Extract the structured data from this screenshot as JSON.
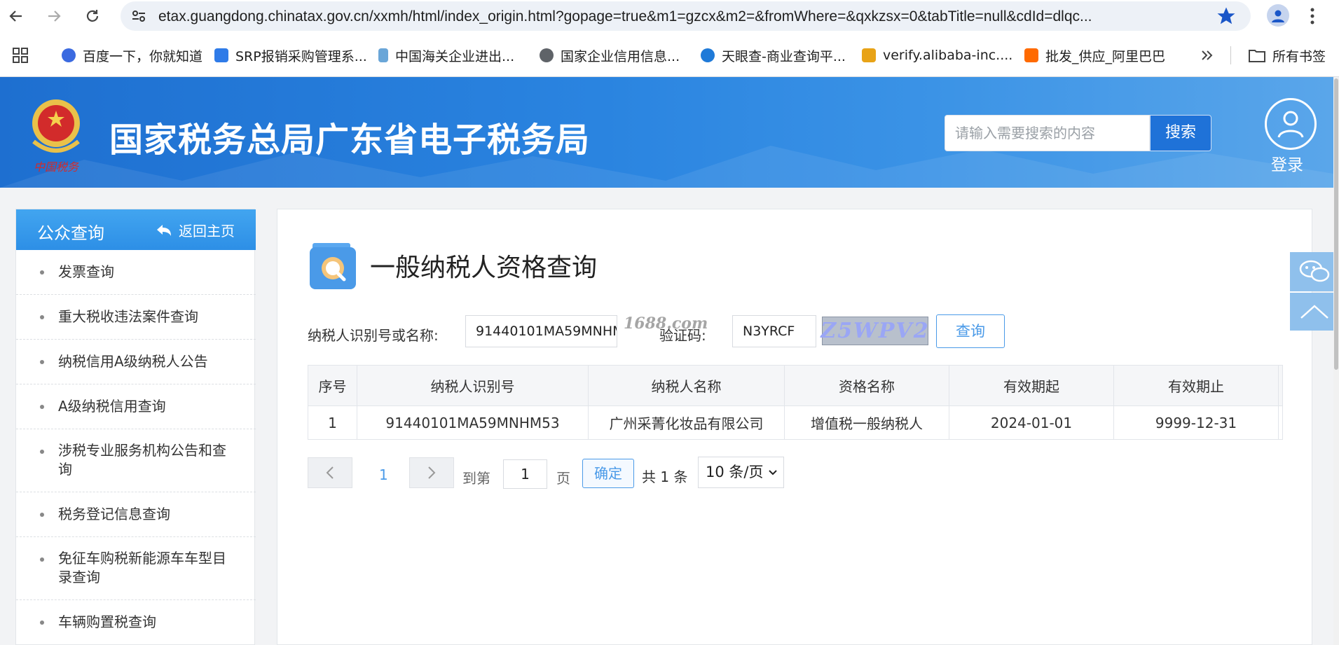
{
  "browser": {
    "url": "etax.guangdong.chinatax.gov.cn/xxmh/html/index_origin.html?gopage=true&m1=gzcx&m2=&fromWhere=&qxkzsx=0&tabTitle=null&cdId=dlqc...",
    "bookmarks": [
      {
        "label": "百度一下，你就知道",
        "color": "#3b6ae0"
      },
      {
        "label": "SRP报销采购管理系...",
        "color": "#2f7be8"
      },
      {
        "label": "中国海关企业进出...",
        "color": "#6aa6d8"
      },
      {
        "label": "国家企业信用信息...",
        "color": "#5f6368"
      },
      {
        "label": "天眼查-商业查询平...",
        "color": "#1f7ad8"
      },
      {
        "label": "verify.alibaba-inc....",
        "color": "#e8a317"
      },
      {
        "label": "批发_供应_阿里巴巴",
        "color": "#ff6a00"
      }
    ],
    "all_bookmarks": "所有书签"
  },
  "header": {
    "title": "国家税务总局广东省电子税务局",
    "search_placeholder": "请输入需要搜索的内容",
    "search_button": "搜索",
    "login_label": "登录",
    "emblem_caption": "中国税务"
  },
  "sidebar": {
    "title": "公众查询",
    "back_label": "返回主页",
    "items": [
      {
        "label": "发票查询"
      },
      {
        "label": "重大税收违法案件查询"
      },
      {
        "label": "纳税信用A级纳税人公告"
      },
      {
        "label": "A级纳税信用查询"
      },
      {
        "label": "涉税专业服务机构公告和查询"
      },
      {
        "label": "税务登记信息查询"
      },
      {
        "label": "免征车购税新能源车车型目录查询"
      },
      {
        "label": "车辆购置税查询"
      }
    ]
  },
  "main": {
    "title": "一般纳税人资格查询",
    "taxpayer_label": "纳税人识别号或名称:",
    "taxpayer_value": "91440101MA59MNHM",
    "captcha_label": "验证码:",
    "captcha_value": "N3YRCF",
    "captcha_image_text": "Z5WPV2",
    "query_button": "查询",
    "watermark": "1688.com",
    "table": {
      "headers": [
        "序号",
        "纳税人识别号",
        "纳税人名称",
        "资格名称",
        "有效期起",
        "有效期止"
      ],
      "rows": [
        [
          "1",
          "91440101MA59MNHM53",
          "广州采菁化妆品有限公司",
          "增值税一般纳税人",
          "2024-01-01",
          "9999-12-31"
        ]
      ]
    },
    "pager": {
      "current_page": "1",
      "goto_label": "到第",
      "page_input": "1",
      "page_unit": "页",
      "confirm": "确定",
      "total": "共 1 条",
      "page_size": "10 条/页"
    }
  }
}
